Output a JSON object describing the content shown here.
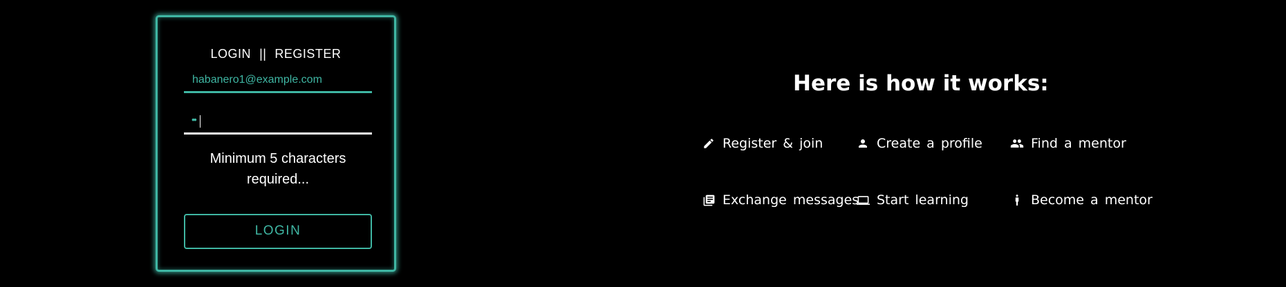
{
  "auth": {
    "login_tab": "LOGIN",
    "separator": "||",
    "register_tab": "REGISTER",
    "email_value": "habanero1@example.com",
    "password_value": "••",
    "validation_message": "Minimum 5 characters required...",
    "login_button": "LOGIN"
  },
  "how_it_works": {
    "title": "Here is how it works:",
    "steps": [
      {
        "label": "Register & join",
        "icon": "pencil-icon"
      },
      {
        "label": "Create a profile",
        "icon": "person-icon"
      },
      {
        "label": "Find a mentor",
        "icon": "people-icon"
      },
      {
        "label": "Exchange messages",
        "icon": "messages-icon"
      },
      {
        "label": "Start learning",
        "icon": "laptop-icon"
      },
      {
        "label": "Become a mentor",
        "icon": "standing-person-icon"
      }
    ]
  },
  "colors": {
    "accent": "#3fb6a3",
    "background": "#000000",
    "text": "#ffffff"
  }
}
